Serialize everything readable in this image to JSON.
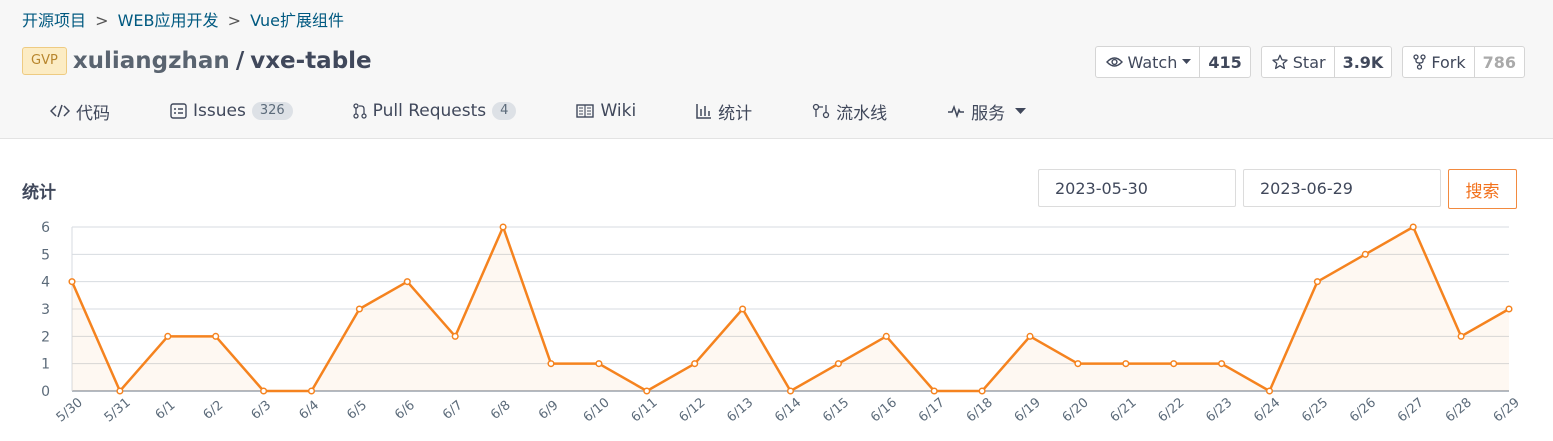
{
  "breadcrumb": {
    "items": [
      "开源项目",
      "WEB应用开发",
      "Vue扩展组件"
    ],
    "separator": ">"
  },
  "repo": {
    "badge": "GVP",
    "owner": "xuliangzhan",
    "separator": "/",
    "name": "vxe-table"
  },
  "actions": {
    "watch": {
      "label": "Watch",
      "count": "415"
    },
    "star": {
      "label": "Star",
      "count": "3.9K"
    },
    "fork": {
      "label": "Fork",
      "count": "786"
    }
  },
  "tabs": [
    {
      "label": "代码",
      "icon": "code-icon"
    },
    {
      "label": "Issues",
      "badge": "326",
      "icon": "issues-icon"
    },
    {
      "label": "Pull Requests",
      "badge": "4",
      "icon": "pull-request-icon"
    },
    {
      "label": "Wiki",
      "icon": "book-icon"
    },
    {
      "label": "统计",
      "icon": "bar-chart-icon"
    },
    {
      "label": "流水线",
      "icon": "pipeline-icon"
    },
    {
      "label": "服务",
      "icon": "pulse-icon"
    }
  ],
  "stats": {
    "title": "统计",
    "start_date": "2023-05-30",
    "end_date": "2023-06-29",
    "search_label": "搜索"
  },
  "colors": {
    "accent": "#f2711c",
    "line": "#f5831f",
    "link": "#005980"
  },
  "chart_data": {
    "type": "area",
    "title": "",
    "xlabel": "",
    "ylabel": "",
    "categories": [
      "5/30",
      "5/31",
      "6/1",
      "6/2",
      "6/3",
      "6/4",
      "6/5",
      "6/6",
      "6/7",
      "6/8",
      "6/9",
      "6/10",
      "6/11",
      "6/12",
      "6/13",
      "6/14",
      "6/15",
      "6/16",
      "6/17",
      "6/18",
      "6/19",
      "6/20",
      "6/21",
      "6/22",
      "6/23",
      "6/24",
      "6/25",
      "6/26",
      "6/27",
      "6/28",
      "6/29"
    ],
    "values": [
      4,
      0,
      2,
      2,
      0,
      0,
      3,
      4,
      2,
      6,
      1,
      1,
      0,
      1,
      3,
      0,
      1,
      2,
      0,
      0,
      2,
      1,
      1,
      1,
      1,
      0,
      4,
      5,
      6,
      2,
      3
    ],
    "ylim": [
      0,
      6
    ],
    "yticks": [
      0,
      1,
      2,
      3,
      4,
      5,
      6
    ],
    "grid": true
  }
}
